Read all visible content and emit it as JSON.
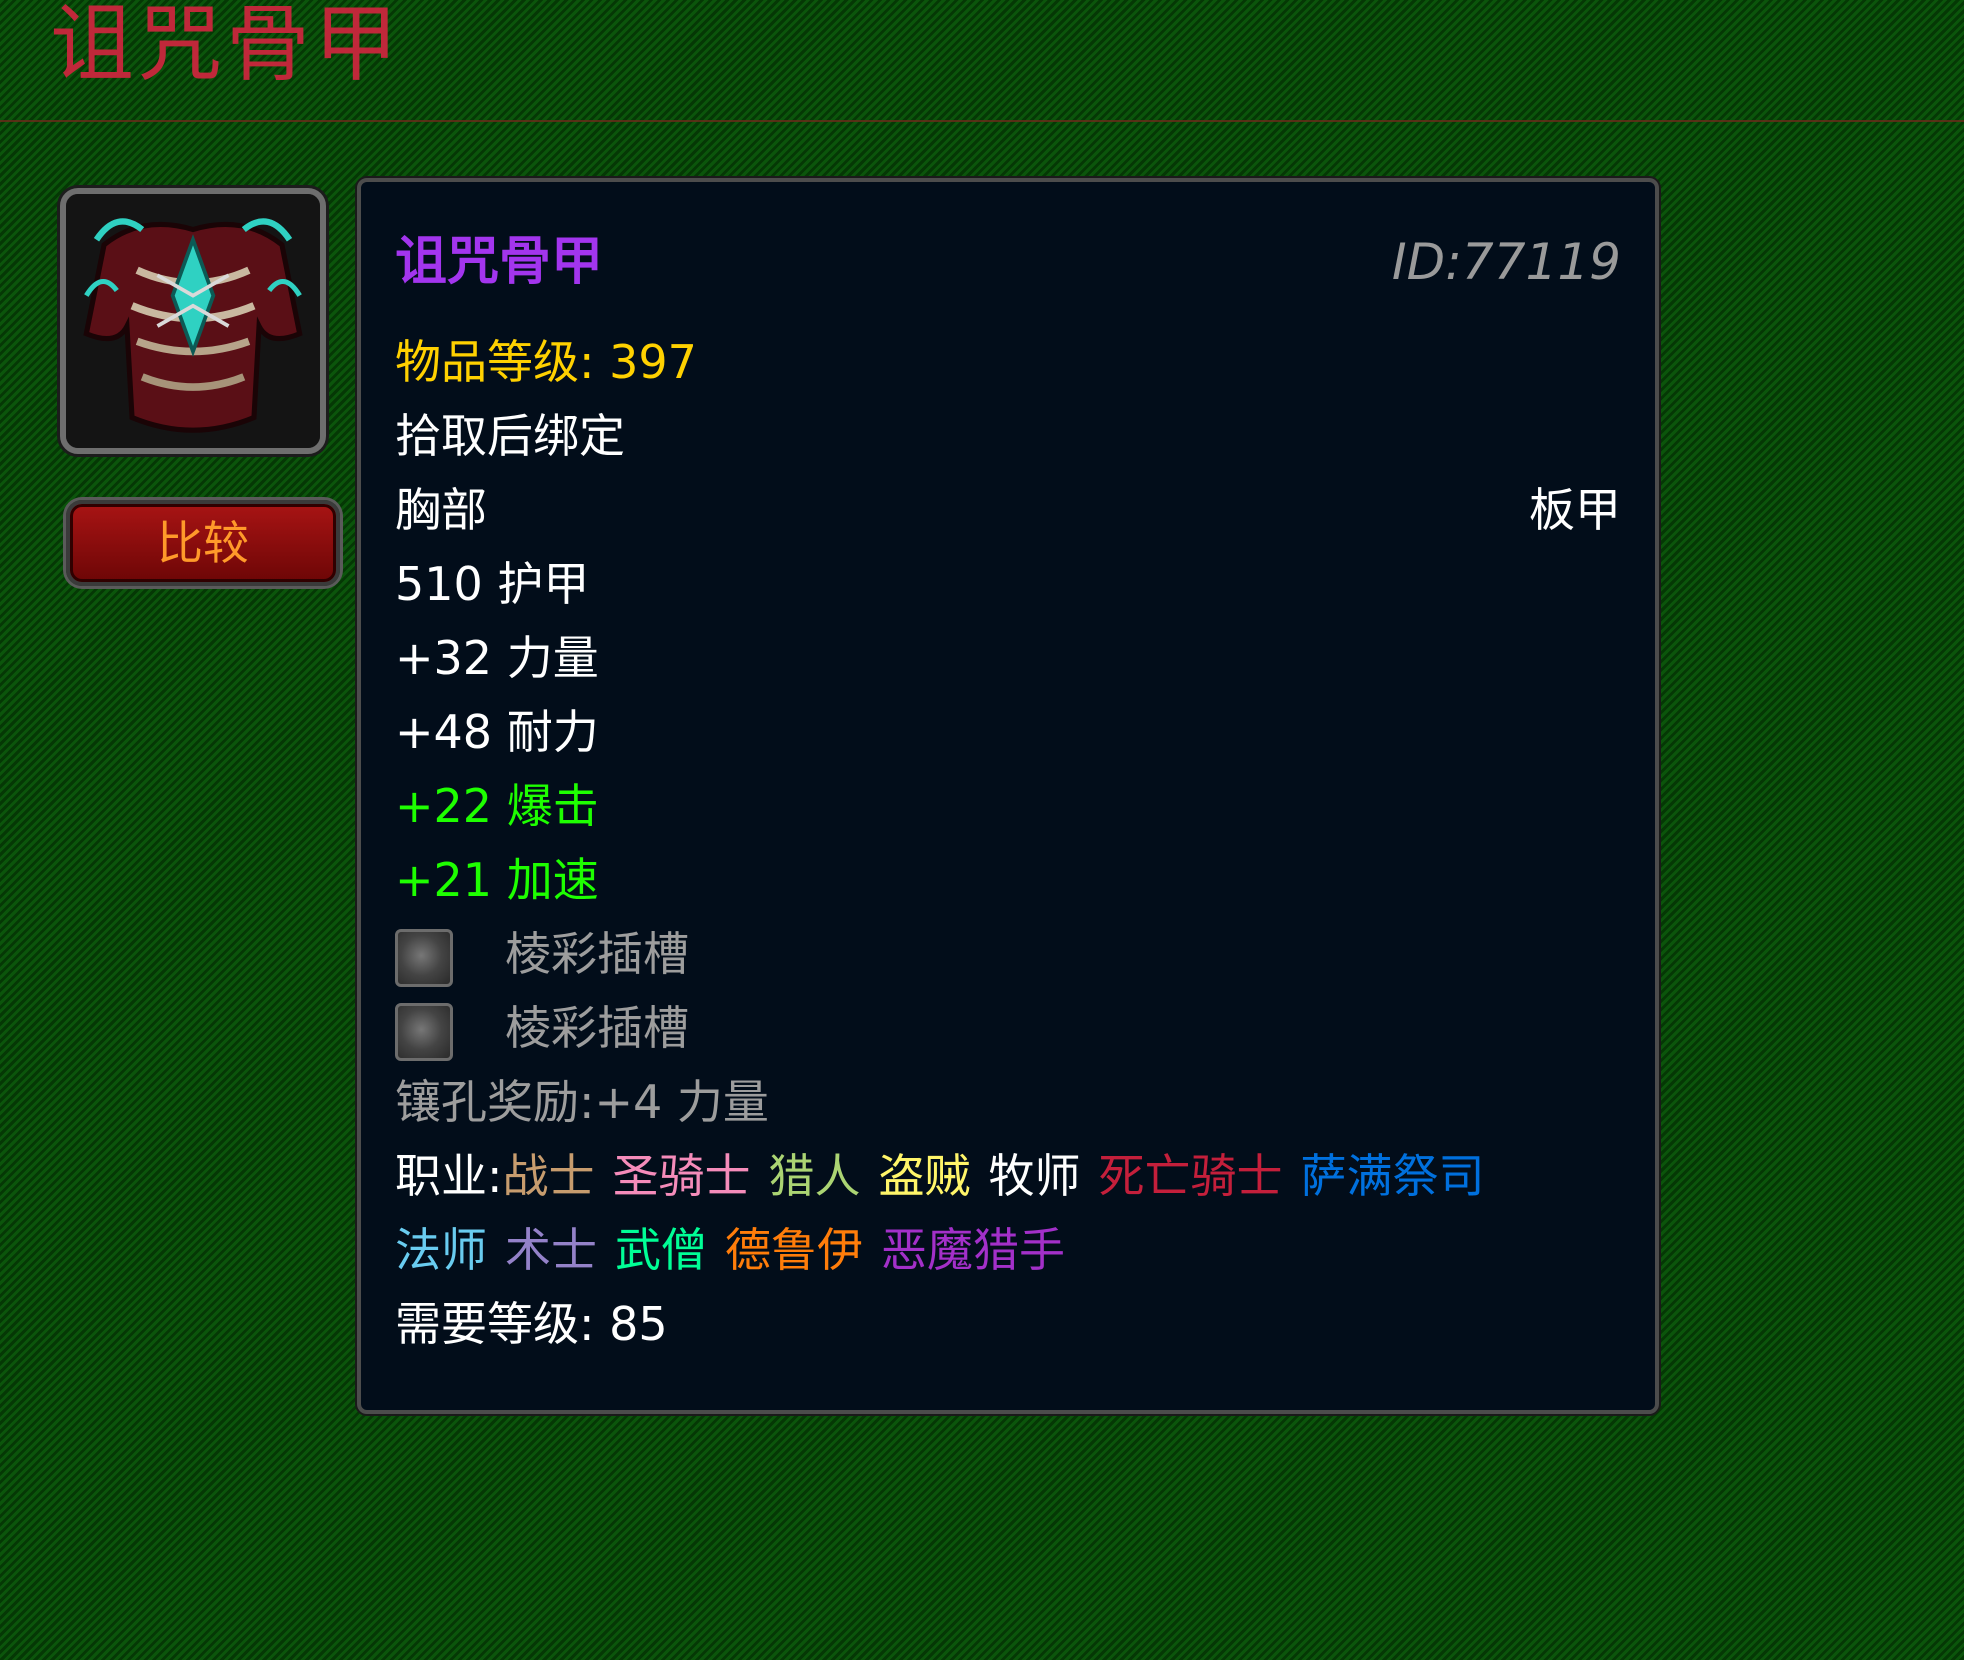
{
  "page": {
    "title": "诅咒骨甲"
  },
  "compare_button": {
    "label": "比较"
  },
  "item": {
    "icon": "chest-armor-icon",
    "name": "诅咒骨甲",
    "id_text": "ID:77119",
    "item_level": "物品等级: 397",
    "binding": "拾取后绑定",
    "slot": "胸部",
    "armor_type": "板甲",
    "armor": "510 护甲",
    "stats": [
      "+32 力量",
      "+48 耐力"
    ],
    "green_stats": [
      "+22 爆击",
      "+21 加速"
    ],
    "sockets": [
      {
        "icon": "prismatic-socket-icon",
        "label": "棱彩插槽"
      },
      {
        "icon": "prismatic-socket-icon",
        "label": "棱彩插槽"
      }
    ],
    "socket_bonus": "镶孔奖励:+4 力量",
    "classes_prefix": "职业:",
    "classes": [
      {
        "name": "战士",
        "color": "#c79c6e"
      },
      {
        "name": "圣骑士",
        "color": "#f58cba"
      },
      {
        "name": "猎人",
        "color": "#abd473"
      },
      {
        "name": "盗贼",
        "color": "#fff569"
      },
      {
        "name": "牧师",
        "color": "#ffffff"
      },
      {
        "name": "死亡骑士",
        "color": "#c41f3b"
      },
      {
        "name": "萨满祭司",
        "color": "#0070de"
      },
      {
        "name": "法师",
        "color": "#69ccf0"
      },
      {
        "name": "术士",
        "color": "#9482c9"
      },
      {
        "name": "武僧",
        "color": "#00ff96"
      },
      {
        "name": "德鲁伊",
        "color": "#ff7d0a"
      },
      {
        "name": "恶魔猎手",
        "color": "#a330c9"
      }
    ],
    "required_level": "需要等级: 85"
  },
  "colors": {
    "background_green": "#0a4f0a",
    "title_red": "#c0283a",
    "epic_purple": "#a335ee",
    "item_level_yellow": "#ffd100",
    "green_stat": "#1eff00",
    "tooltip_bg": "#020d1a"
  }
}
